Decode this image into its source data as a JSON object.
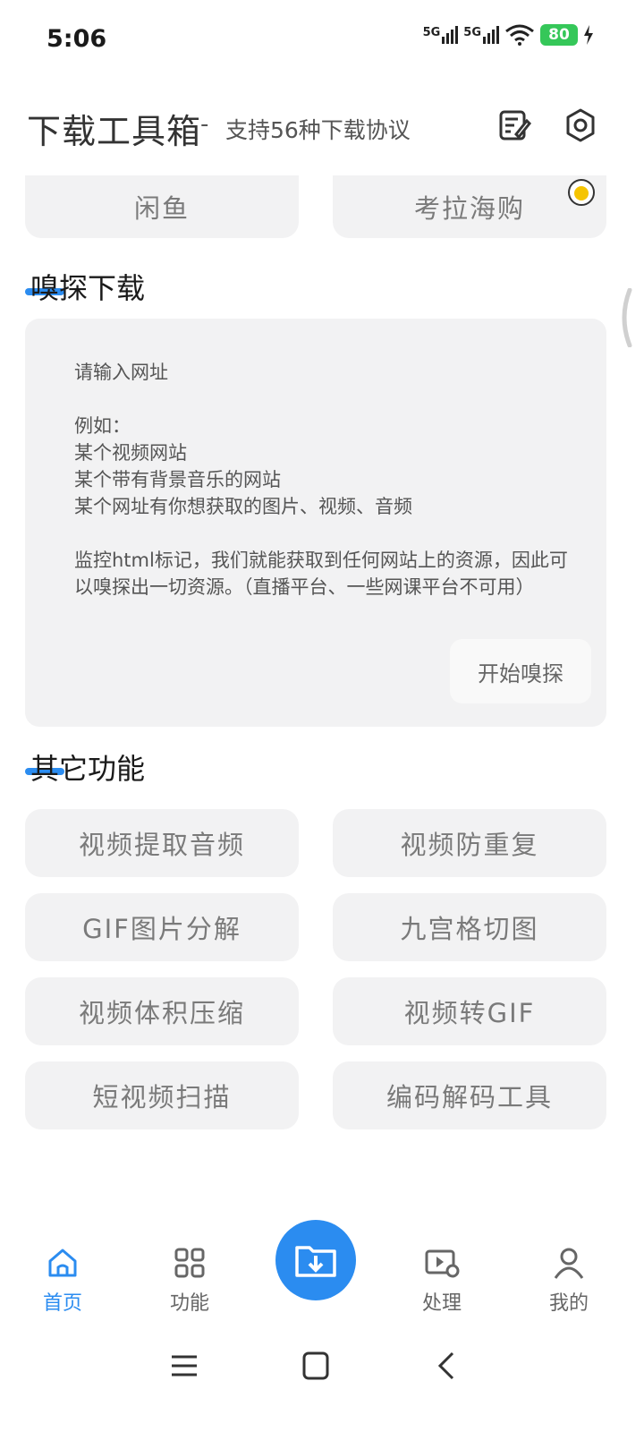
{
  "status": {
    "time": "5:06",
    "signal1": "5G",
    "signal2": "5G",
    "battery": "80"
  },
  "header": {
    "title": "下载工具箱",
    "separator": "-",
    "subtitle": "支持56种下载协议"
  },
  "top_buttons": [
    "闲鱼",
    "考拉海购"
  ],
  "sniff": {
    "section_title": "嗅探下载",
    "placeholder": "请输入网址\n\n例如：\n某个视频网站\n某个带有背景音乐的网站\n某个网址有你想获取的图片、视频、音频\n\n监控html标记，我们就能获取到任何网站上的资源，因此可以嗅探出一切资源。（直播平台、一些网课平台不可用）",
    "start_label": "开始嗅探"
  },
  "other": {
    "section_title": "其它功能",
    "buttons": [
      "视频提取音频",
      "视频防重复",
      "GIF图片分解",
      "九宫格切图",
      "视频体积压缩",
      "视频转GIF",
      "短视频扫描",
      "编码解码工具"
    ]
  },
  "nav": {
    "home": "首页",
    "features": "功能",
    "process": "处理",
    "mine": "我的"
  },
  "colors": {
    "accent": "#2b8cf0",
    "button_bg": "#f2f2f3"
  }
}
